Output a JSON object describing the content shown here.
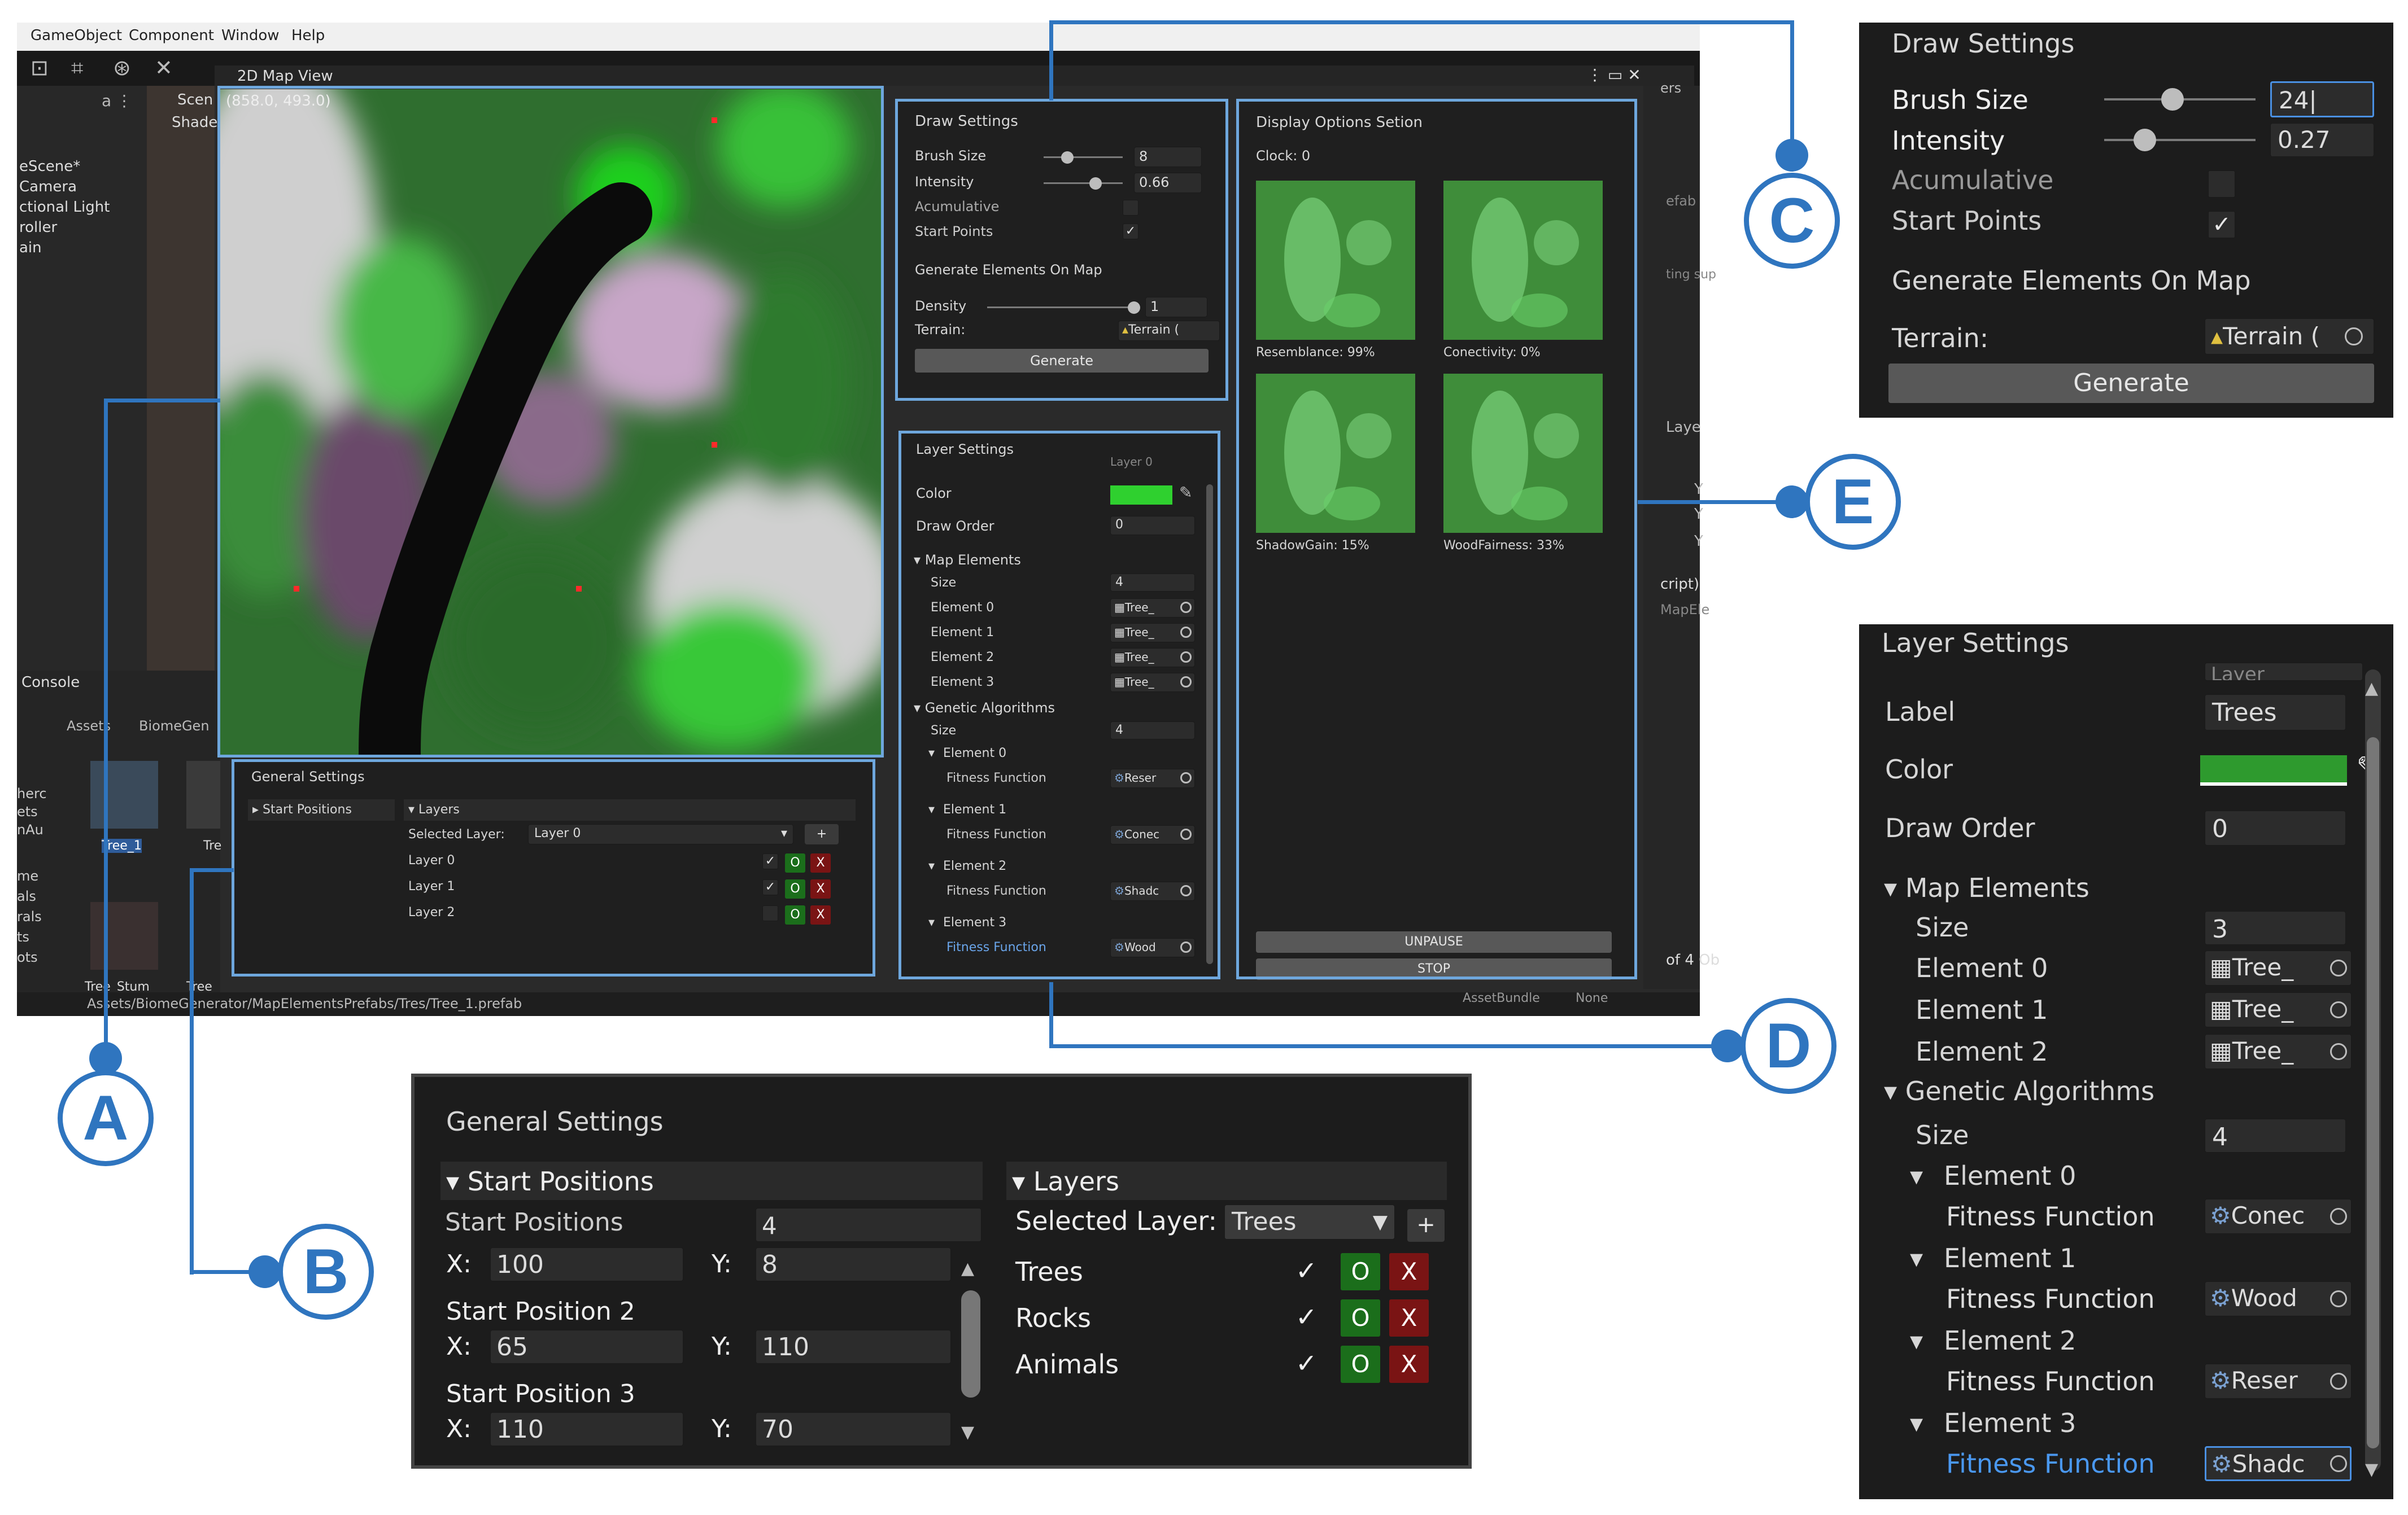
{
  "menu": {
    "items": [
      "GameObject",
      "Component",
      "Window",
      "Help"
    ]
  },
  "map_view": {
    "tab_title": "2D Map View",
    "coords": "(858.0, 493.0)",
    "scene_tab": "Scen",
    "shading": "Shaded"
  },
  "hierarchy": {
    "items": [
      "eScene*",
      "Camera",
      "ctional Light",
      "roller",
      "ain"
    ]
  },
  "console": {
    "title": "Console",
    "breadcrumb": [
      "Assets",
      "BiomeGen"
    ],
    "side_items": [
      "herc",
      "ets",
      "nAu",
      "me",
      "als",
      "rals",
      "ts",
      "ots"
    ],
    "assets": [
      "Tree_1",
      "Tre",
      "Tree_Stum",
      "Tree"
    ],
    "path": "Assets/BiomeGenerator/MapElementsPrefabs/Tres/Tree_1.prefab"
  },
  "inspector_fragments": {
    "items": [
      "efab",
      "ting sup",
      "Laye",
      "Y",
      "Y",
      "Y",
      "cript)",
      "MapEle",
      "of 4 Ob",
      "AssetBundle",
      "None",
      "ers"
    ]
  },
  "draw_settings_small": {
    "title": "Draw Settings",
    "brush_size_label": "Brush Size",
    "brush_size": "8",
    "intensity_label": "Intensity",
    "intensity": "0.66",
    "acumulative_label": "Acumulative",
    "start_points_label": "Start Points",
    "check": "✓",
    "generate_header": "Generate Elements On Map",
    "density_label": "Density",
    "density": "1",
    "terrain_label": "Terrain:",
    "terrain": "Terrain (",
    "generate_button": "Generate",
    "brush_frac": 0.3,
    "intensity_frac": 0.66,
    "density_frac": 1.0
  },
  "display_options": {
    "title": "Display Options Setion",
    "clock": "Clock: 0",
    "thumbs": [
      "Resemblance: 99%",
      "Conectivity: 0%",
      "ShadowGain: 15%",
      "WoodFairness: 33%"
    ],
    "unpause_button": "UNPAUSE",
    "stop_button": "STOP"
  },
  "layer_settings_small": {
    "title": "Layer Settings",
    "cut_label": "Label",
    "cut_value": "Layer 0",
    "color_label": "Color",
    "draw_order_label": "Draw Order",
    "draw_order": "0",
    "map_elements": "Map Elements",
    "size_label": "Size",
    "map_size": "4",
    "elements": [
      {
        "label": "Element 0",
        "value": "Tree_"
      },
      {
        "label": "Element 1",
        "value": "Tree_"
      },
      {
        "label": "Element 2",
        "value": "Tree_"
      },
      {
        "label": "Element 3",
        "value": "Tree_"
      }
    ],
    "genetic": "Genetic Algorithms",
    "gen_size": "4",
    "gen_elements": [
      {
        "label": "Element 0",
        "value": "Reser"
      },
      {
        "label": "Element 1",
        "value": "Conec"
      },
      {
        "label": "Element 2",
        "value": "Shadc"
      },
      {
        "label": "Element 3",
        "value": "Wood"
      }
    ],
    "fitness_label": "Fitness Function"
  },
  "general_small": {
    "title": "General Settings",
    "start_positions": "Start Positions",
    "layers": "Layers",
    "selected_layer_label": "Selected Layer:",
    "selected_layer": "Layer 0",
    "plus": "+",
    "layer_rows": [
      {
        "name": "Layer 0",
        "checked": "✓"
      },
      {
        "name": "Layer 1",
        "checked": "✓"
      },
      {
        "name": "Layer 2",
        "checked": ""
      }
    ],
    "o": "O",
    "x": "X"
  },
  "zoom_c": {
    "title": "Draw Settings",
    "brush_size_label": "Brush Size",
    "brush_size": "24",
    "intensity_label": "Intensity",
    "intensity": "0.27",
    "acumulative_label": "Acumulative",
    "start_points_label": "Start Points",
    "check": "✓",
    "generate_header": "Generate Elements On Map",
    "terrain_label": "Terrain:",
    "terrain": "Terrain (",
    "generate_button": "Generate",
    "brush_frac": 0.45,
    "intensity_frac": 0.27
  },
  "zoom_b": {
    "title": "General Settings",
    "start_positions_header": "Start Positions",
    "start_positions_label": "Start Positions",
    "start_positions_count": "4",
    "x_label": "X:",
    "y_label": "Y:",
    "positions": [
      {
        "label": "",
        "x": "100",
        "y": "8"
      },
      {
        "label": "Start Position 2",
        "x": "65",
        "y": "110"
      },
      {
        "label": "Start Position 3",
        "x": "110",
        "y": "70"
      }
    ],
    "layers_header": "Layers",
    "selected_layer_label": "Selected Layer:",
    "selected_layer": "Trees",
    "plus": "+",
    "layer_rows": [
      {
        "name": "Trees",
        "checked": "✓"
      },
      {
        "name": "Rocks",
        "checked": "✓"
      },
      {
        "name": "Animals",
        "checked": "✓"
      }
    ],
    "o": "O",
    "x": "X"
  },
  "zoom_d": {
    "title": "Layer Settings",
    "cut_value": "Layer",
    "label_label": "Label",
    "label_value": "Trees",
    "color_label": "Color",
    "color_hex": "#2e9a2e",
    "draw_order_label": "Draw Order",
    "draw_order": "0",
    "map_elements": "Map Elements",
    "size_label": "Size",
    "map_size": "3",
    "elements": [
      {
        "label": "Element 0",
        "value": "Tree_"
      },
      {
        "label": "Element 1",
        "value": "Tree_"
      },
      {
        "label": "Element 2",
        "value": "Tree_"
      }
    ],
    "genetic": "Genetic Algorithms",
    "gen_size": "4",
    "gen_elements": [
      {
        "label": "Element 0",
        "value": "Conec"
      },
      {
        "label": "Element 1",
        "value": "Wood"
      },
      {
        "label": "Element 2",
        "value": "Reser"
      },
      {
        "label": "Element 3",
        "value": "Shadc"
      }
    ],
    "fitness_label": "Fitness Function"
  },
  "callouts": {
    "a": "A",
    "b": "B",
    "c": "C",
    "d": "D",
    "e": "E"
  },
  "colors": {
    "accent": "#2f75bf",
    "highlight_box": "#6ea7dd",
    "panel": "#1f1f1f",
    "green_button": "#1b6e1b",
    "red_button": "#7a1414",
    "layer_color_small": "#2fd02f"
  }
}
